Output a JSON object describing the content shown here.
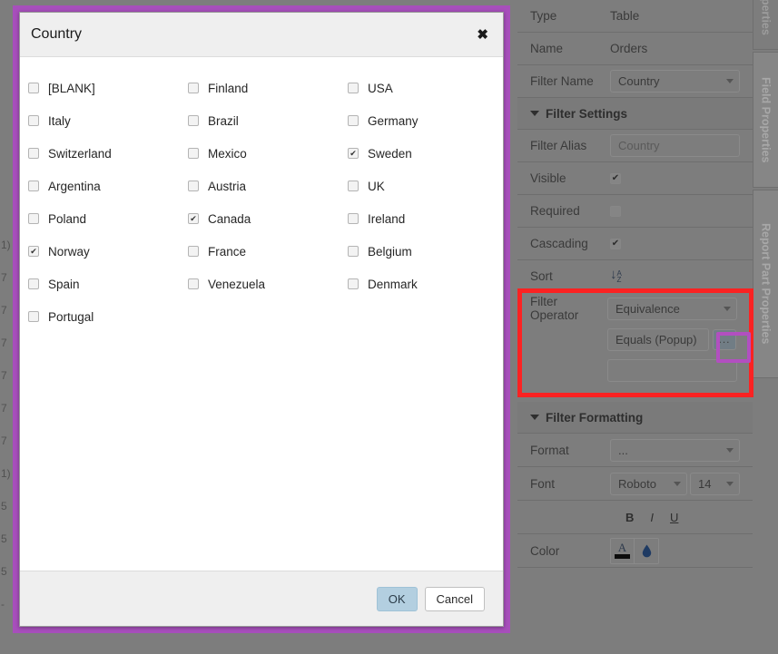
{
  "background": {
    "left_fragments": [
      "",
      "",
      "",
      "",
      "",
      "",
      "",
      "1)",
      "7",
      "7",
      "7",
      "7",
      "7",
      "7",
      "1)",
      "5",
      "5",
      "5",
      "-"
    ]
  },
  "properties_panel": {
    "rows": [
      {
        "label": "Type",
        "value": "Table"
      },
      {
        "label": "Name",
        "value": "Orders"
      }
    ],
    "filter_name": {
      "label": "Filter Name",
      "value": "Country"
    },
    "filter_settings": {
      "title": "Filter Settings",
      "filter_alias": {
        "label": "Filter Alias",
        "value": "Country"
      },
      "visible": {
        "label": "Visible",
        "checked": true,
        "mark": "✔"
      },
      "required": {
        "label": "Required",
        "checked": false,
        "mark": ""
      },
      "cascading": {
        "label": "Cascading",
        "checked": true,
        "mark": "✔"
      },
      "sort": {
        "label": "Sort",
        "icon": "sort-az-icon",
        "arrow": "↓",
        "a": "A",
        "z": "Z"
      }
    },
    "filter_operator": {
      "label": "Filter Operator",
      "operator_value": "Equivalence",
      "equals_value": "Equals (Popup)",
      "ellipsis_label": "...",
      "empty_value": "",
      "highlight_color": "#fb2222",
      "ellipsis_highlight_color": "#b24fc0"
    },
    "filter_formatting": {
      "title": "Filter Formatting",
      "format": {
        "label": "Format",
        "value": "..."
      },
      "font": {
        "label": "Font",
        "family": "Roboto",
        "size": "14"
      },
      "styles": {
        "bold": "B",
        "italic": "I",
        "underline": "U"
      },
      "color": {
        "label": "Color",
        "text_color_glyph": "A",
        "fill_glyph": "💧"
      }
    }
  },
  "tabs": [
    {
      "label": "Properties",
      "active": true
    },
    {
      "label": "Field Properties",
      "active": false
    },
    {
      "label": "Report Part Properties",
      "active": false
    }
  ],
  "modal": {
    "title": "Country",
    "close_label": "✖",
    "border_color": "#a74fbb",
    "countries": [
      {
        "label": "[BLANK]",
        "checked": false,
        "mark": ""
      },
      {
        "label": "Finland",
        "checked": false,
        "mark": ""
      },
      {
        "label": "USA",
        "checked": false,
        "mark": ""
      },
      {
        "label": "Italy",
        "checked": false,
        "mark": ""
      },
      {
        "label": "Brazil",
        "checked": false,
        "mark": ""
      },
      {
        "label": "Germany",
        "checked": false,
        "mark": ""
      },
      {
        "label": "Switzerland",
        "checked": false,
        "mark": ""
      },
      {
        "label": "Mexico",
        "checked": false,
        "mark": ""
      },
      {
        "label": "Sweden",
        "checked": true,
        "mark": "✔"
      },
      {
        "label": "Argentina",
        "checked": false,
        "mark": ""
      },
      {
        "label": "Austria",
        "checked": false,
        "mark": ""
      },
      {
        "label": "UK",
        "checked": false,
        "mark": ""
      },
      {
        "label": "Poland",
        "checked": false,
        "mark": ""
      },
      {
        "label": "Canada",
        "checked": true,
        "mark": "✔"
      },
      {
        "label": "Ireland",
        "checked": false,
        "mark": ""
      },
      {
        "label": "Norway",
        "checked": true,
        "mark": "✔"
      },
      {
        "label": "France",
        "checked": false,
        "mark": ""
      },
      {
        "label": "Belgium",
        "checked": false,
        "mark": ""
      },
      {
        "label": "Spain",
        "checked": false,
        "mark": ""
      },
      {
        "label": "Venezuela",
        "checked": false,
        "mark": ""
      },
      {
        "label": "Denmark",
        "checked": false,
        "mark": ""
      },
      {
        "label": "Portugal",
        "checked": false,
        "mark": ""
      }
    ],
    "ok_label": "OK",
    "cancel_label": "Cancel"
  }
}
